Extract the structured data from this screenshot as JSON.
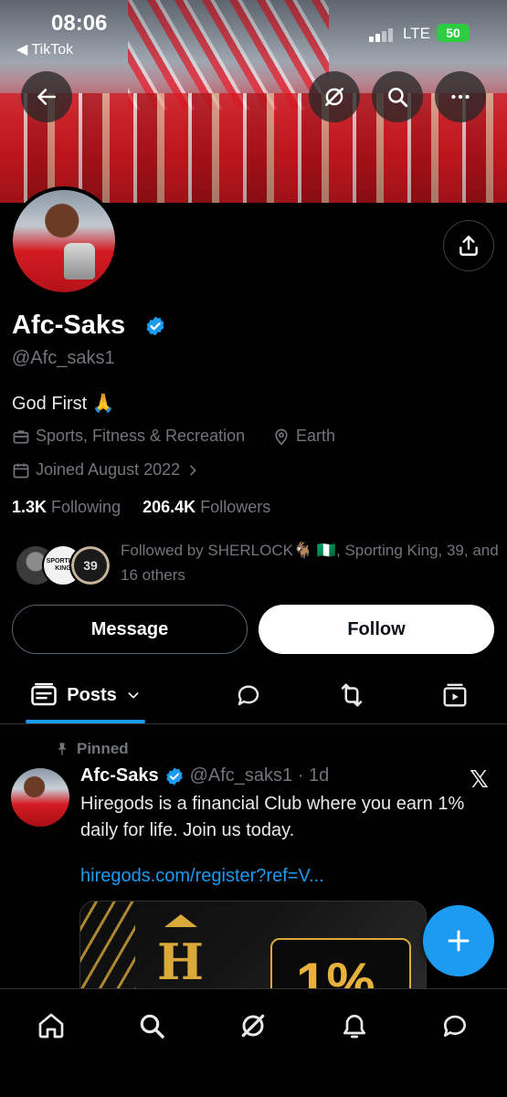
{
  "status_bar": {
    "time": "08:06",
    "back_app": "◀ TikTok",
    "network": "LTE",
    "battery": "50"
  },
  "header_actions": {
    "back_icon": "arrow-left-icon",
    "grok_icon": "grok-icon",
    "search_icon": "search-icon",
    "more_icon": "more-icon"
  },
  "profile": {
    "display_name": "Afc-Saks",
    "handle": "@Afc_saks1",
    "bio": "God First 🙏",
    "category": "Sports, Fitness & Recreation",
    "location": "Earth",
    "joined": "Joined August 2022",
    "following_count": "1.3K",
    "following_label": "Following",
    "followers_count": "206.4K",
    "followers_label": "Followers",
    "followed_by": "Followed by SHERLOCK🐐 🇳🇬, Sporting King, 39, and 16 others",
    "follower_badge_text": "39",
    "sporting_badge_text": "SPORTING KING"
  },
  "actions": {
    "message_label": "Message",
    "follow_label": "Follow"
  },
  "tabs": {
    "posts_label": "Posts"
  },
  "pinned_post": {
    "pinned_label": "Pinned",
    "author": "Afc-Saks",
    "meta": "@Afc_saks1 · 1d",
    "text": "Hiregods is a financial Club where you earn 1% daily for life. Join us today.",
    "link": "hiregods.com/register?ref=V...",
    "media_logo_letter": "H",
    "media_percent": "1%"
  },
  "colors": {
    "accent": "#1d9bf0",
    "background": "#000000",
    "muted": "#71767b"
  }
}
